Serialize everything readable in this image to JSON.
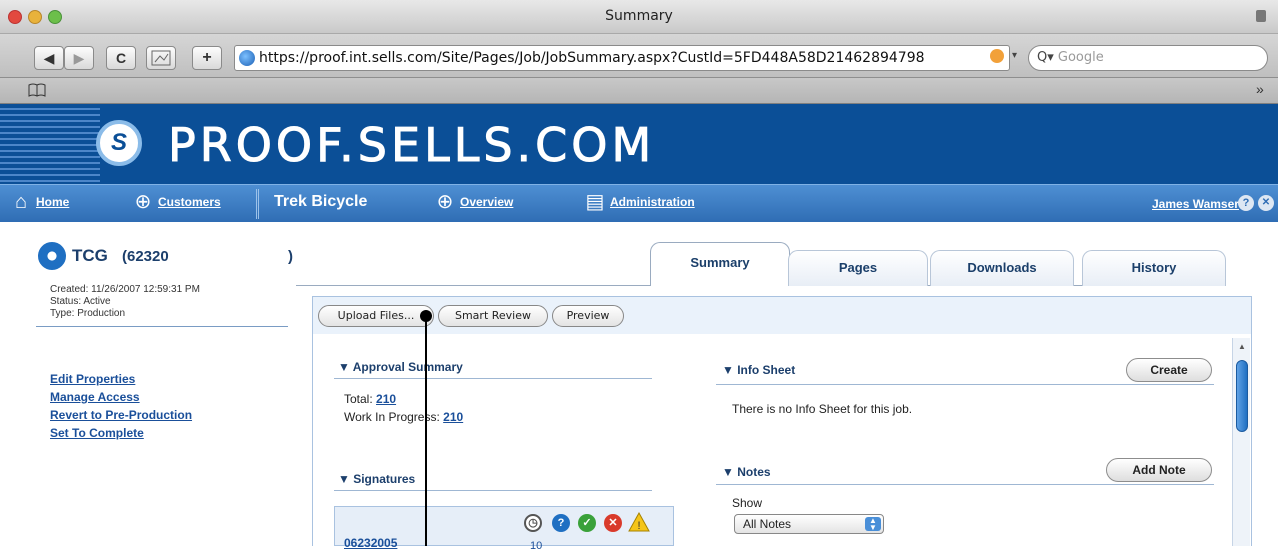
{
  "window": {
    "title": "Summary"
  },
  "toolbar": {
    "back": "◀",
    "forward": "▶",
    "reload": "C",
    "plus": "+",
    "url": "https://proof.int.sells.com/Site/Pages/Job/JobSummary.aspx?CustId=5FD448A58D21462894798",
    "search_placeholder": "Google",
    "search_prefix": "Q▾"
  },
  "bookmarks": {
    "book_icon": "book-icon",
    "overflow": "»"
  },
  "banner": {
    "logo_text": "PROOF.SELLS.COM"
  },
  "nav": {
    "home": "Home",
    "customers": "Customers",
    "company": "Trek Bicycle",
    "overview": "Overview",
    "administration": "Administration",
    "user": "James Wamser",
    "help": "?",
    "close": "✕"
  },
  "job": {
    "title": "TCG",
    "number": "(62320",
    "close_paren": ")"
  },
  "tabs": [
    {
      "label": "Summary",
      "active": true
    },
    {
      "label": "Pages"
    },
    {
      "label": "Downloads"
    },
    {
      "label": "History"
    }
  ],
  "sidebar": {
    "created": "Created: 11/26/2007 12:59:31 PM",
    "status": "Status: Active",
    "type": "Type: Production",
    "links": [
      "Edit Properties",
      "Manage Access",
      "Revert to Pre-Production",
      "Set To Complete"
    ]
  },
  "actions": {
    "upload": "Upload Files...",
    "smart_review": "Smart Review",
    "preview": "Preview"
  },
  "approval": {
    "title": "▼ Approval Summary",
    "total_label": "Total:",
    "total_value": "210",
    "wip_label": "Work In Progress:",
    "wip_value": "210"
  },
  "signatures": {
    "title": "▼ Signatures",
    "row_id": "06232005",
    "cell_value": "10"
  },
  "info_sheet": {
    "title": "▼ Info Sheet",
    "create": "Create",
    "message": "There is no Info Sheet for this job."
  },
  "notes": {
    "title": "▼ Notes",
    "add": "Add Note",
    "show_label": "Show",
    "filter": "All Notes"
  },
  "colors": {
    "banner": "#0b4f97",
    "nav": "#3a7bc4",
    "link": "#1a4f9a"
  }
}
